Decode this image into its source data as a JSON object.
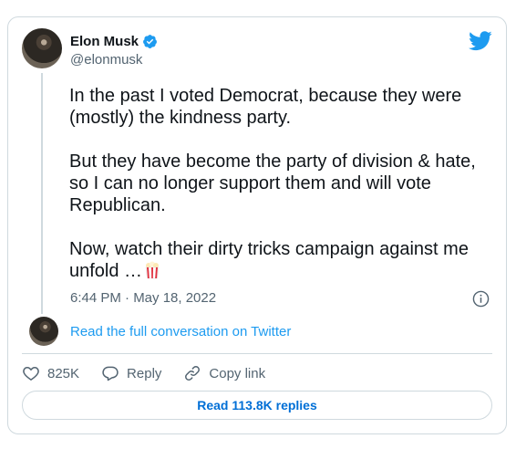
{
  "author": {
    "display_name": "Elon Musk",
    "handle": "@elonmusk",
    "verified": true
  },
  "tweet": {
    "paragraphs": [
      "In the past I voted Democrat, because they were\n(mostly) the kindness party.",
      "But they have become the party of division & hate,\nso I can no longer support them and will vote\nRepublican.",
      "Now, watch their dirty tricks campaign against me\nunfold …"
    ],
    "emoji": "popcorn-icon",
    "timestamp": "6:44 PM · May 18, 2022"
  },
  "conversation_link": "Read the full conversation on Twitter",
  "actions": {
    "likes": "825K",
    "reply_label": "Reply",
    "copy_label": "Copy link"
  },
  "read_replies": "Read 113.8K replies",
  "colors": {
    "accent": "#1d9bf0",
    "reply_link": "#006fd6",
    "muted": "#536471",
    "border": "#cfd9de"
  }
}
